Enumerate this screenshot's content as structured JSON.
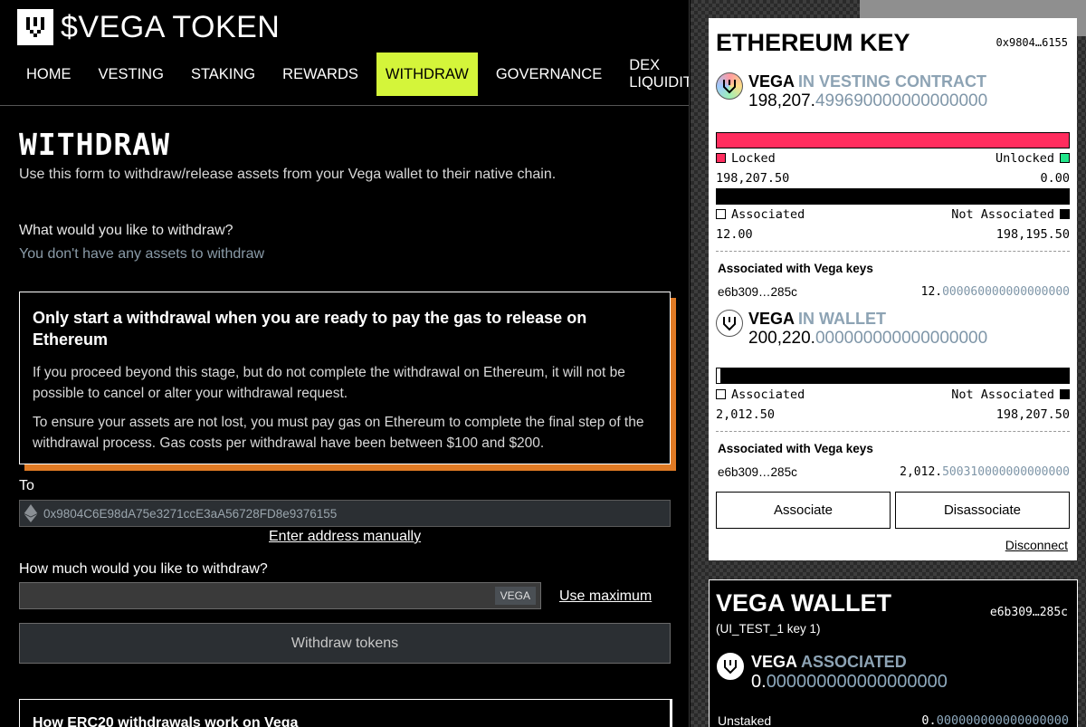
{
  "app": {
    "title": "$VEGA TOKEN",
    "logo_icon": "vega-logo-icon"
  },
  "nav": {
    "items": [
      {
        "label": "HOME"
      },
      {
        "label": "VESTING"
      },
      {
        "label": "STAKING"
      },
      {
        "label": "REWARDS"
      },
      {
        "label": "WITHDRAW",
        "active": true
      },
      {
        "label": "GOVERNANCE"
      },
      {
        "label": "DEX\nLIQUIDITY"
      }
    ],
    "active_color": "#d4f53a"
  },
  "main": {
    "title": "WITHDRAW",
    "description": "Use this form to withdraw/release assets from your Vega wallet to their native chain.",
    "asset_question": "What would you like to withdraw?",
    "no_assets": "You don't have any assets to withdraw",
    "warning": {
      "heading": "Only start a withdrawal when you are ready to pay the gas to release on Ethereum",
      "p1": "If you proceed beyond this stage, but do not complete the withdrawal on Ethereum, it will not be possible to cancel or alter your withdrawal request.",
      "p2": "To ensure your assets are not lost, you must pay gas on Ethereum to complete the final step of the withdrawal process. Gas costs per withdrawal have been between $100 and $200.",
      "accent_color": "#e07a24"
    },
    "to_label": "To",
    "to_address": "0x9804C6E98dA75e3271ccE3aA56728FD8e9376155",
    "manual_link": "Enter address manually",
    "amount_question": "How much would you like to withdraw?",
    "amount_unit": "VEGA",
    "use_maximum": "Use maximum",
    "withdraw_button": "Withdraw tokens",
    "bottom_heading": "How ERC20 withdrawals work on Vega"
  },
  "eth_key": {
    "title": "ETHEREUM KEY",
    "address_short": "0x9804…6155",
    "vesting": {
      "token": "VEGA",
      "status": "IN VESTING CONTRACT",
      "amount_int": "198,207.",
      "amount_dec": "499690000000000000",
      "locked_label": "Locked",
      "unlocked_label": "Unlocked",
      "locked_value": "198,207.50",
      "unlocked_value": "0.00",
      "locked_fraction": 1.0,
      "associated_label": "Associated",
      "not_associated_label": "Not Associated",
      "associated_value": "12.00",
      "not_associated_value": "198,195.50",
      "assoc_keys_title": "Associated with Vega keys",
      "assoc_key": "e6b309…285c",
      "assoc_int": "12.",
      "assoc_dec": "000060000000000000"
    },
    "wallet": {
      "token": "VEGA",
      "status": "IN WALLET",
      "amount_int": "200,220.",
      "amount_dec": "000000000000000000",
      "associated_label": "Associated",
      "not_associated_label": "Not Associated",
      "associated_value": "2,012.50",
      "not_associated_value": "198,207.50",
      "associated_fraction": 0.01,
      "assoc_keys_title": "Associated with Vega keys",
      "assoc_key": "e6b309…285c",
      "assoc_int": "2,012.",
      "assoc_dec": "500310000000000000"
    },
    "associate_button": "Associate",
    "disassociate_button": "Disassociate",
    "disconnect": "Disconnect"
  },
  "vega_wallet": {
    "title": "VEGA WALLET",
    "key_short": "e6b309…285c",
    "key_name": "(UI_TEST_1 key 1)",
    "token": "VEGA",
    "status": "ASSOCIATED",
    "amount_int": "0.",
    "amount_dec": "000000000000000000",
    "unstaked_label": "Unstaked",
    "unstaked_int": "0.",
    "unstaked_dec": "000000000000000000"
  },
  "colors": {
    "locked": "#ff2d5e",
    "unlocked": "#22e58a",
    "muted_decimal": "#7f96a8"
  }
}
